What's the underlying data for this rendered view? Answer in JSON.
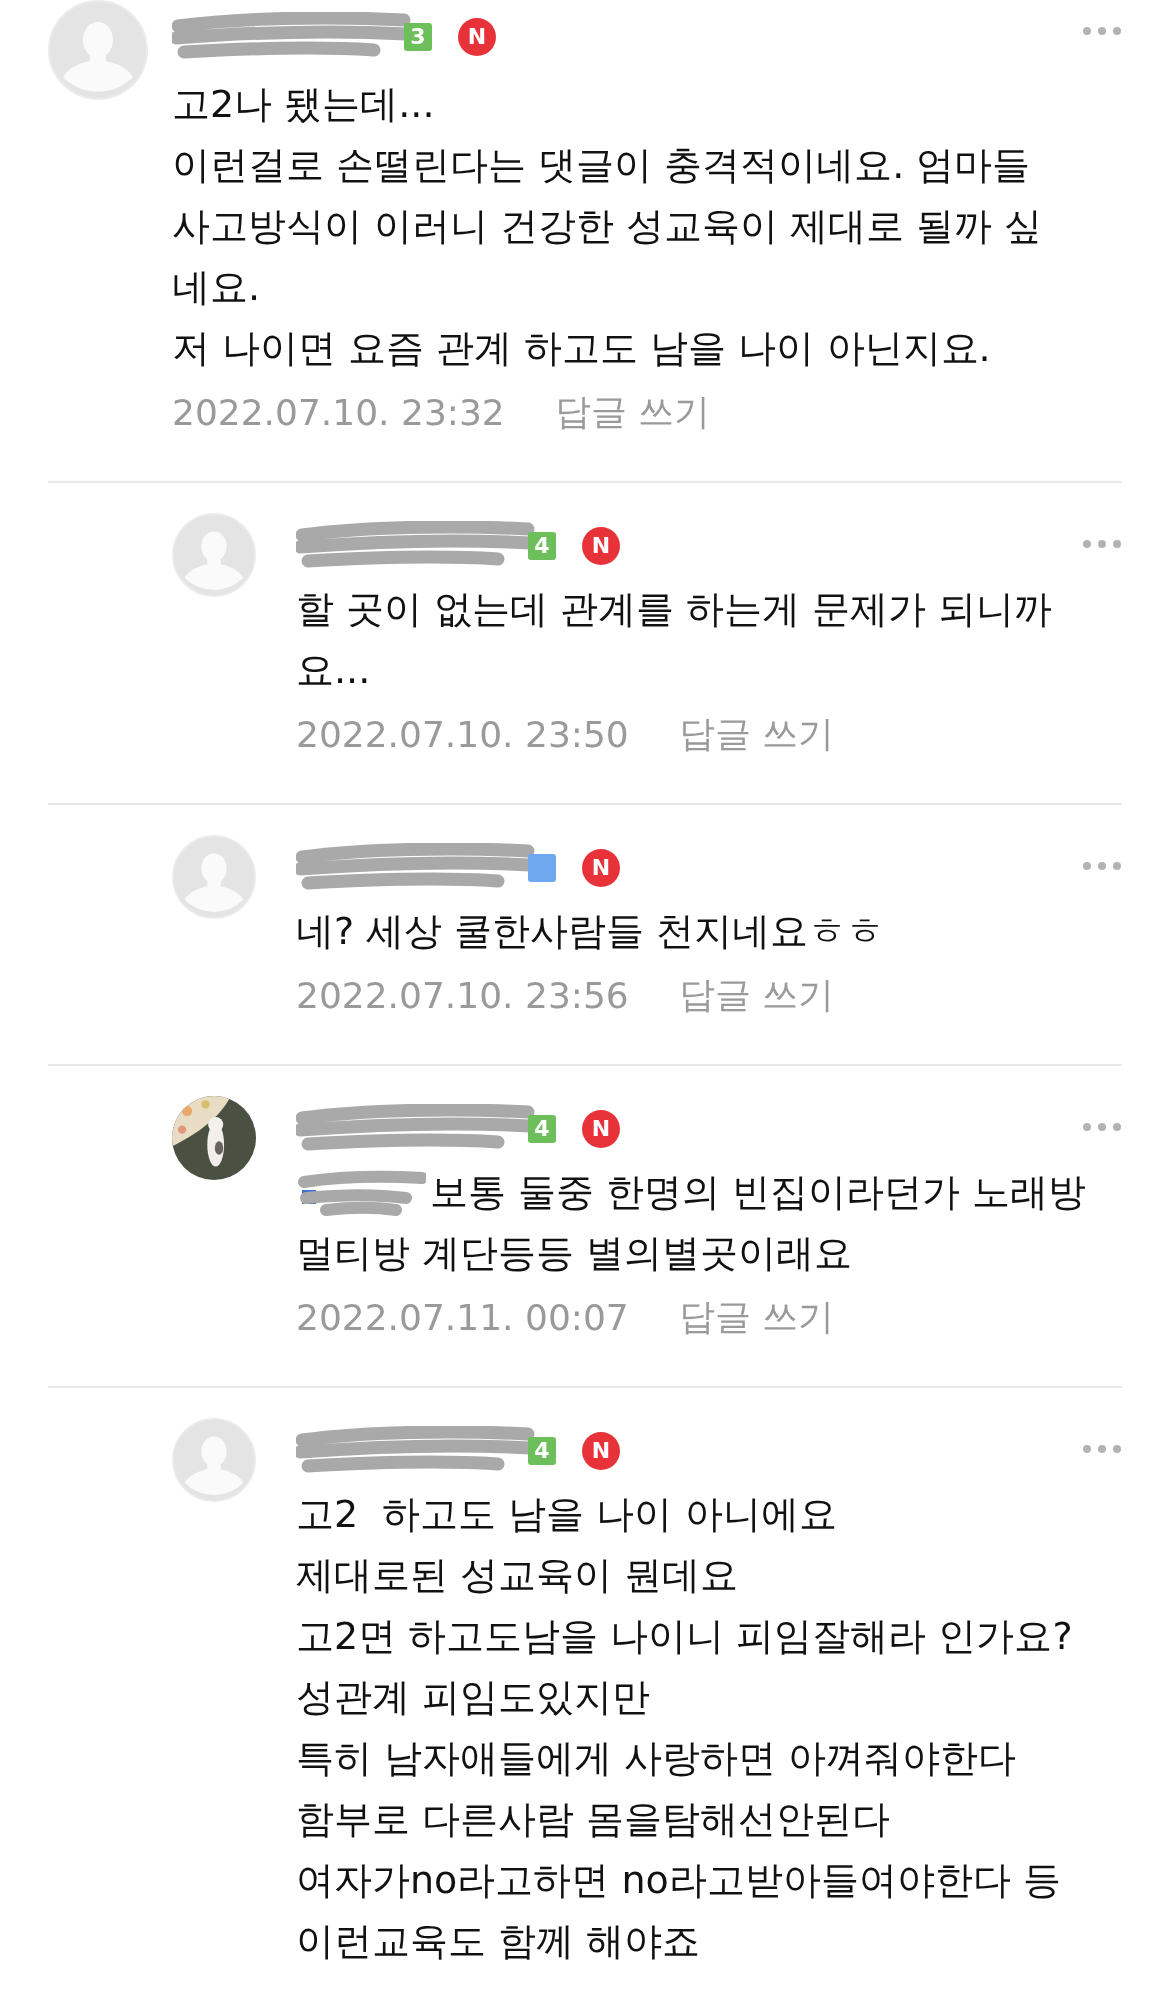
{
  "comments": [
    {
      "reply": false,
      "avatar": {
        "kind": "default"
      },
      "name_redacted": true,
      "level_badge": {
        "text": "3",
        "color": "#6cbf5a"
      },
      "new_mark": "N",
      "mention": false,
      "lines": [
        "고2나 됐는데...",
        "이런걸로 손떨린다는 댓글이 충격적이네요. 엄마들",
        "사고방식이 이러니 건강한 성교육이 제대로 될까 싶",
        "네요.",
        "저 나이면 요즘 관계 하고도 남을 나이 아닌지요."
      ],
      "date": "2022.07.10. 23:32",
      "reply_link": "답글 쓰기"
    },
    {
      "reply": true,
      "avatar": {
        "kind": "default"
      },
      "name_redacted": true,
      "level_badge": {
        "text": "4",
        "color": "#6cbf5a"
      },
      "new_mark": "N",
      "mention": false,
      "lines": [
        "할 곳이 없는데 관계를 하는게 문제가 되니까",
        "요..."
      ],
      "date": "2022.07.10. 23:50",
      "reply_link": "답글 쓰기"
    },
    {
      "reply": true,
      "avatar": {
        "kind": "default"
      },
      "name_redacted": true,
      "level_badge": {
        "color": "#6fa8ee"
      },
      "new_mark": "N",
      "mention": false,
      "lines": [
        "네? 세상 쿨한사람들 천지네요ㅎㅎ"
      ],
      "date": "2022.07.10. 23:56",
      "reply_link": "답글 쓰기"
    },
    {
      "reply": true,
      "name_redacted": true,
      "level_badge": {
        "text": "4",
        "color": "#6cbf5a"
      },
      "new_mark": "N",
      "mention": true,
      "lines": [
        "보통 둘중 한명의 빈집이라던가 노래방",
        "멀티방 계단등등 별의별곳이래요"
      ],
      "date": "2022.07.11. 00:07",
      "reply_link": "답글 쓰기"
    },
    {
      "reply": true,
      "avatar": {
        "kind": "default"
      },
      "name_redacted": true,
      "level_badge": {
        "text": "4",
        "color": "#6cbf5a"
      },
      "new_mark": "N",
      "mention": false,
      "lines": [
        "고2  하고도 남을 나이 아니에요",
        "제대로된 성교육이 뭔데요",
        "고2면 하고도남을 나이니 피임잘해라 인가요?",
        "성관계 피임도있지만",
        "특히 남자애들에게 사랑하면 아껴줘야한다",
        "함부로 다른사람 몸을탐해선안된다",
        "여자가no라고하면 no라고받아들여야한다 등",
        "이런교육도 함께 해야죠"
      ]
    }
  ]
}
